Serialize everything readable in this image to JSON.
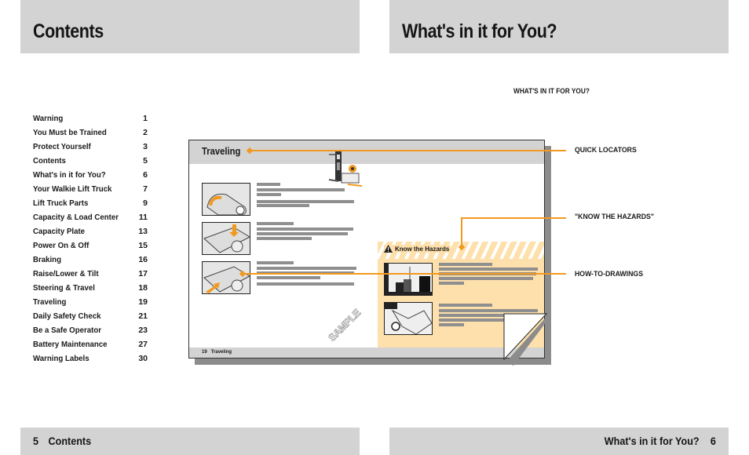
{
  "left_page": {
    "header_title": "Contents",
    "toc": [
      {
        "label": "Warning",
        "page": "1"
      },
      {
        "label": "You Must be Trained",
        "page": "2"
      },
      {
        "label": "Protect Yourself",
        "page": "3"
      },
      {
        "label": "Contents",
        "page": "5"
      },
      {
        "label": "What's in it for You?",
        "page": "6"
      },
      {
        "label": "Your Walkie Lift Truck",
        "page": "7"
      },
      {
        "label": "Lift Truck Parts",
        "page": "9"
      },
      {
        "label": "Capacity & Load Center",
        "page": "11"
      },
      {
        "label": "Capacity Plate",
        "page": "13"
      },
      {
        "label": "Power On & Off",
        "page": "15"
      },
      {
        "label": "Braking",
        "page": "16"
      },
      {
        "label": "Raise/Lower & Tilt",
        "page": "17"
      },
      {
        "label": "Steering & Travel",
        "page": "18"
      },
      {
        "label": "Traveling",
        "page": "19"
      },
      {
        "label": "Daily Safety Check",
        "page": "21"
      },
      {
        "label": "Be a Safe Operator",
        "page": "23"
      },
      {
        "label": "Battery Maintenance",
        "page": "27"
      },
      {
        "label": "Warning Labels",
        "page": "30"
      }
    ],
    "footer_page": "5",
    "footer_title": "Contents"
  },
  "right_page": {
    "header_title": "What's in it for You?",
    "section_label": "WHAT'S IN IT FOR YOU?",
    "callouts": {
      "quick_locators": "QUICK LOCATORS",
      "know_hazards": "\"KNOW THE HAZARDS\"",
      "how_to_drawings": "HOW-TO-DRAWINGS"
    },
    "sample_page": {
      "title": "Traveling",
      "hazard_title": "Know the Hazards",
      "stamp": "SAMPLE",
      "footer_page": "19",
      "footer_title": "Traveling"
    },
    "footer_title": "What's in it for You?",
    "footer_page": "6"
  },
  "colors": {
    "band_gray": "#d3d3d3",
    "accent_orange": "#f29a1f",
    "hazard_fill": "#fde0ab"
  }
}
